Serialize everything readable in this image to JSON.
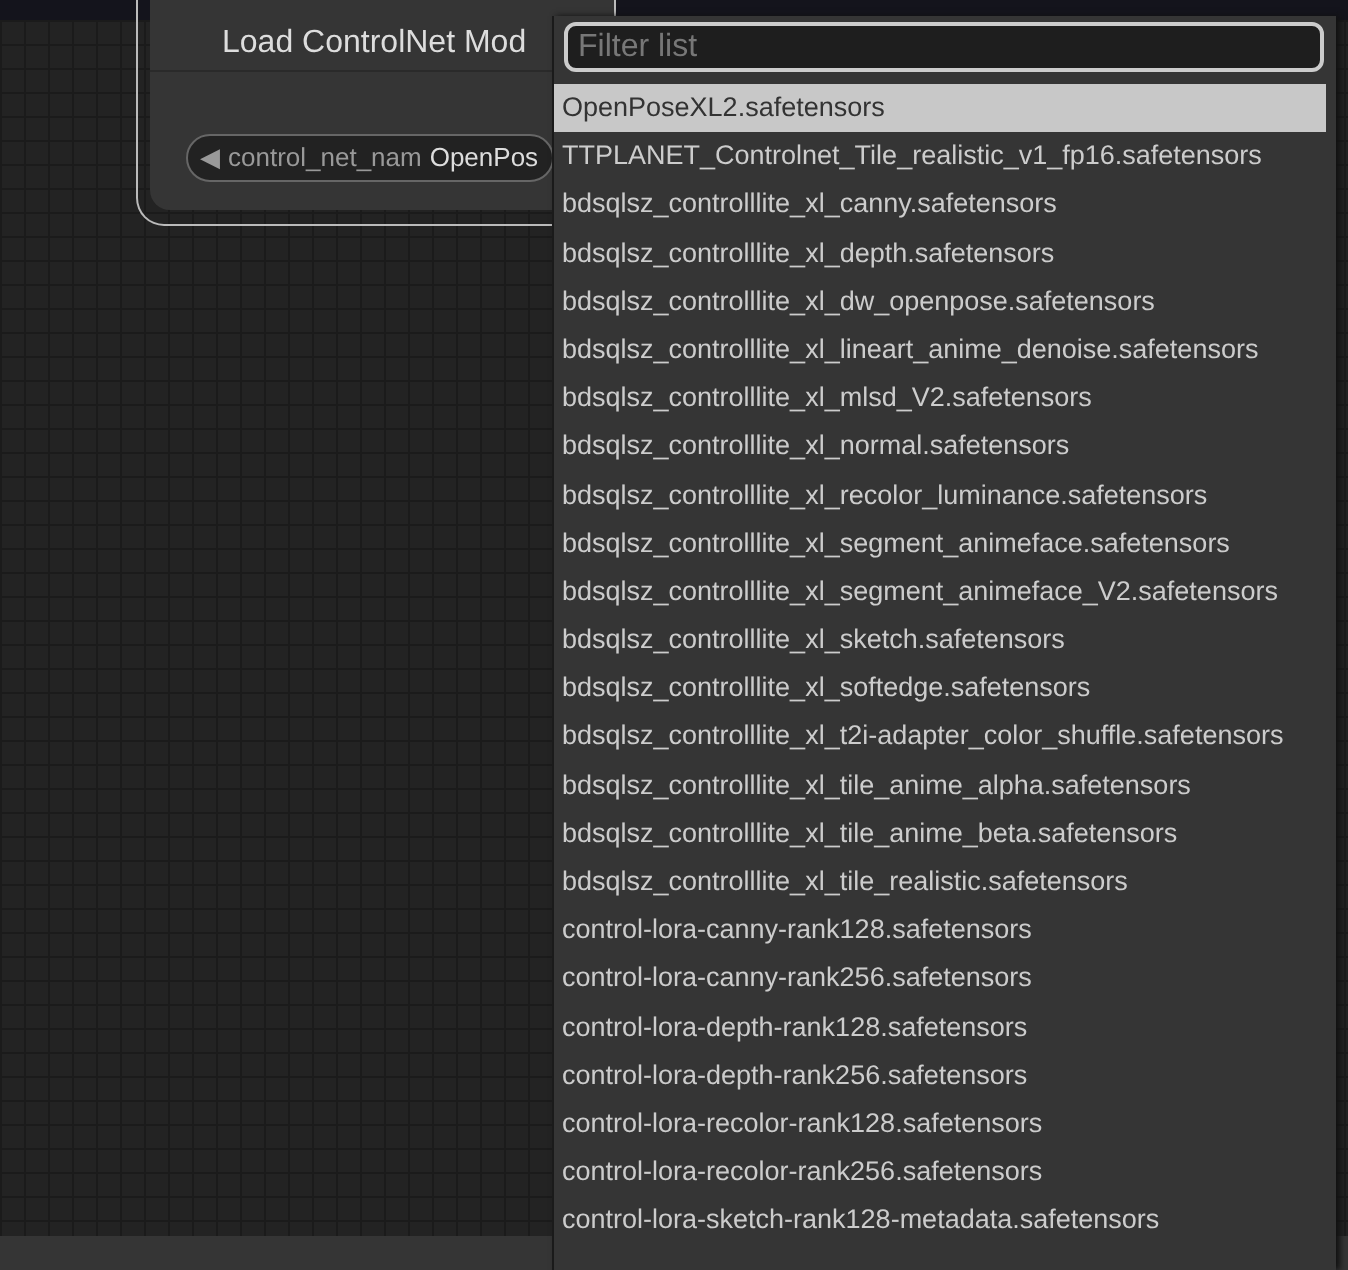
{
  "node": {
    "title": "Load ControlNet Mod",
    "widget": {
      "label": "control_net_nam",
      "value": "OpenPos",
      "arrow": "◀"
    }
  },
  "dropdown": {
    "filter": {
      "placeholder": "Filter list"
    },
    "items": [
      {
        "label": "OpenPoseXL2.safetensors",
        "selected": true
      },
      {
        "label": "TTPLANET_Controlnet_Tile_realistic_v1_fp16.safetensors",
        "selected": false
      },
      {
        "label": "bdsqlsz_controlllite_xl_canny.safetensors",
        "selected": false
      },
      {
        "label": "bdsqlsz_controlllite_xl_depth.safetensors",
        "selected": false
      },
      {
        "label": "bdsqlsz_controlllite_xl_dw_openpose.safetensors",
        "selected": false
      },
      {
        "label": "bdsqlsz_controlllite_xl_lineart_anime_denoise.safetensors",
        "selected": false
      },
      {
        "label": "bdsqlsz_controlllite_xl_mlsd_V2.safetensors",
        "selected": false
      },
      {
        "label": "bdsqlsz_controlllite_xl_normal.safetensors",
        "selected": false
      },
      {
        "label": "bdsqlsz_controlllite_xl_recolor_luminance.safetensors",
        "selected": false
      },
      {
        "label": "bdsqlsz_controlllite_xl_segment_animeface.safetensors",
        "selected": false
      },
      {
        "label": "bdsqlsz_controlllite_xl_segment_animeface_V2.safetensors",
        "selected": false
      },
      {
        "label": "bdsqlsz_controlllite_xl_sketch.safetensors",
        "selected": false
      },
      {
        "label": "bdsqlsz_controlllite_xl_softedge.safetensors",
        "selected": false
      },
      {
        "label": "bdsqlsz_controlllite_xl_t2i-adapter_color_shuffle.safetensors",
        "selected": false
      },
      {
        "label": "bdsqlsz_controlllite_xl_tile_anime_alpha.safetensors",
        "selected": false
      },
      {
        "label": "bdsqlsz_controlllite_xl_tile_anime_beta.safetensors",
        "selected": false
      },
      {
        "label": "bdsqlsz_controlllite_xl_tile_realistic.safetensors",
        "selected": false
      },
      {
        "label": "control-lora-canny-rank128.safetensors",
        "selected": false
      },
      {
        "label": "control-lora-canny-rank256.safetensors",
        "selected": false
      },
      {
        "label": "control-lora-depth-rank128.safetensors",
        "selected": false
      },
      {
        "label": "control-lora-depth-rank256.safetensors",
        "selected": false
      },
      {
        "label": "control-lora-recolor-rank128.safetensors",
        "selected": false
      },
      {
        "label": "control-lora-recolor-rank256.safetensors",
        "selected": false
      },
      {
        "label": "control-lora-sketch-rank128-metadata.safetensors",
        "selected": false
      }
    ]
  }
}
